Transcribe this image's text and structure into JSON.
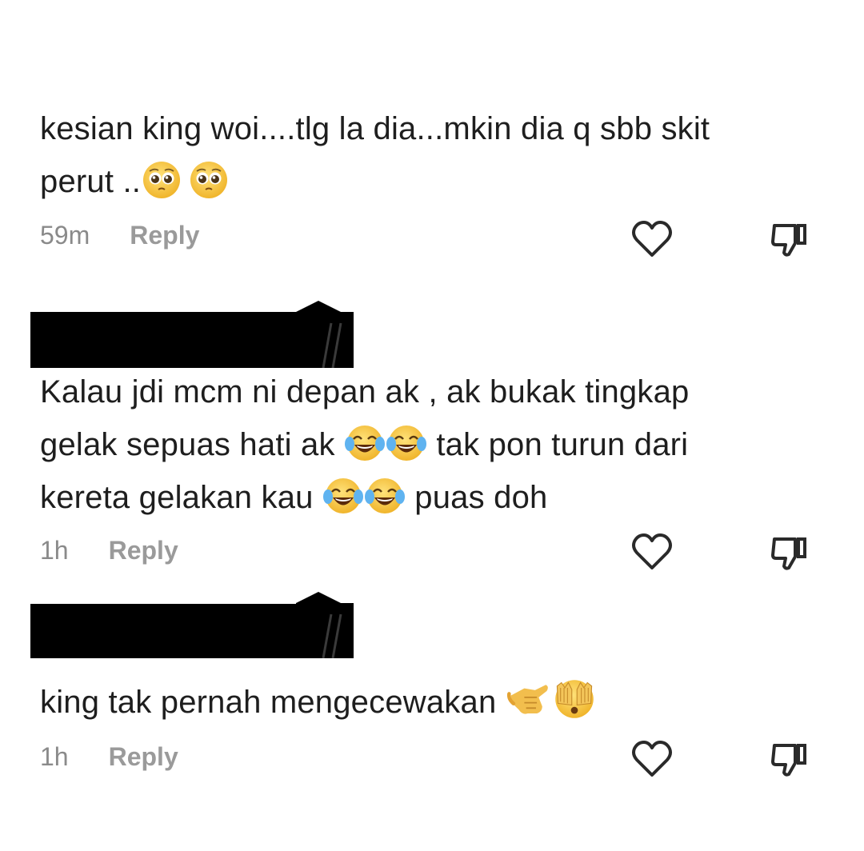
{
  "comments": [
    {
      "line1": "kesian king woi....tlg la dia...mkin dia q sbb skit",
      "line2": "perut ..",
      "time": "59m",
      "reply": "Reply",
      "emojis": [
        "pleading-face-emoji",
        "pleading-face-emoji"
      ]
    },
    {
      "line1": "Kalau jdi mcm ni depan ak , ak bukak tingkap",
      "line2a": "gelak sepuas hati ak",
      "line2b": "tak pon turun dari",
      "line3a": "kereta gelakan kau",
      "line3b": "puas doh",
      "time": "1h",
      "reply": "Reply",
      "emojis": [
        "tears-of-joy-emoji",
        "tears-of-joy-emoji"
      ]
    },
    {
      "line1": "king tak pernah mengecewakan",
      "time": "1h",
      "reply": "Reply",
      "emojis": [
        "call-me-hand-emoji",
        "face-with-hand-over-eyes-emoji"
      ]
    }
  ],
  "icons": {
    "like": "heart-icon",
    "dislike": "thumbs-down-icon"
  },
  "colors": {
    "text": "#1e1e1e",
    "meta": "#8a8a8a",
    "icon": "#2a2a2a",
    "emoji_yellow": "#f6c64a"
  }
}
